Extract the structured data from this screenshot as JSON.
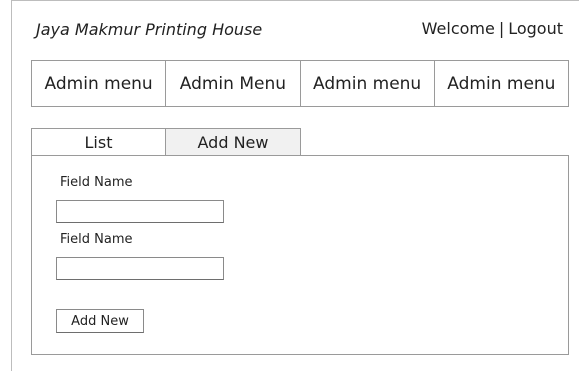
{
  "header": {
    "brand": "Jaya Makmur Printing House",
    "welcome_label": "Welcome",
    "separator": "|",
    "logout_label": "Logout"
  },
  "menu": {
    "items": [
      {
        "label": "Admin menu"
      },
      {
        "label": "Admin Menu"
      },
      {
        "label": "Admin menu"
      },
      {
        "label": "Admin menu"
      }
    ]
  },
  "tabs": [
    {
      "label": "List",
      "active": false
    },
    {
      "label": "Add New",
      "active": true
    }
  ],
  "form": {
    "fields": [
      {
        "label": "Field Name",
        "value": "",
        "placeholder": ""
      },
      {
        "label": "Field Name",
        "value": "",
        "placeholder": ""
      }
    ],
    "submit_label": "Add New"
  }
}
